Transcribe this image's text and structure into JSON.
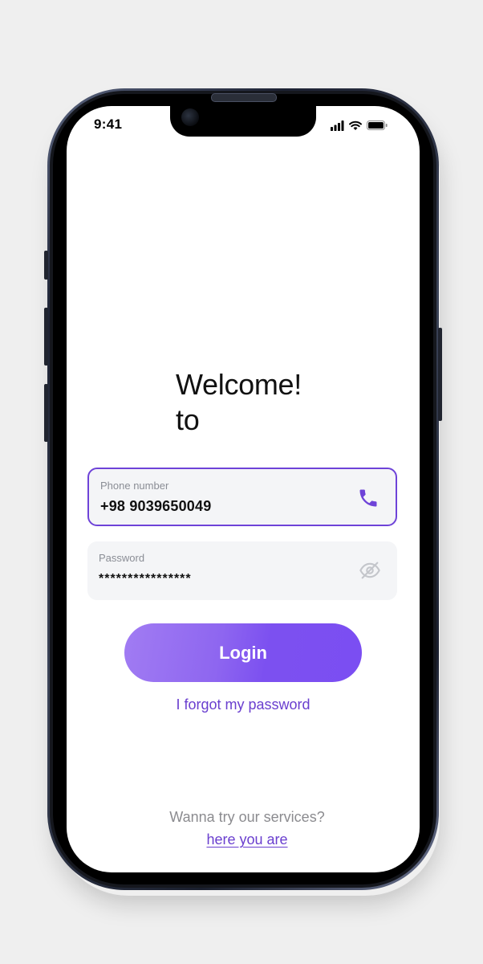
{
  "status_bar": {
    "time": "9:41",
    "icons": [
      "signal-icon",
      "wifi-icon",
      "battery-icon"
    ]
  },
  "welcome": {
    "line1": "Welcome!",
    "line2": "to"
  },
  "phone_field": {
    "label": "Phone number",
    "value": "+98 9039650049",
    "icon": "phone-icon"
  },
  "password_field": {
    "label": "Password",
    "value": "****************",
    "icon": "eye-off-icon"
  },
  "login_button": {
    "label": "Login"
  },
  "forgot_link": {
    "label": "I forgot my password"
  },
  "signup": {
    "prompt": "Wanna try our services?",
    "link": "here you are"
  },
  "colors": {
    "accent": "#6e43d8",
    "button_start": "#a17cf3",
    "button_end": "#7b4ef2",
    "field_bg": "#f4f5f7",
    "muted_text": "#8b8b8f"
  }
}
